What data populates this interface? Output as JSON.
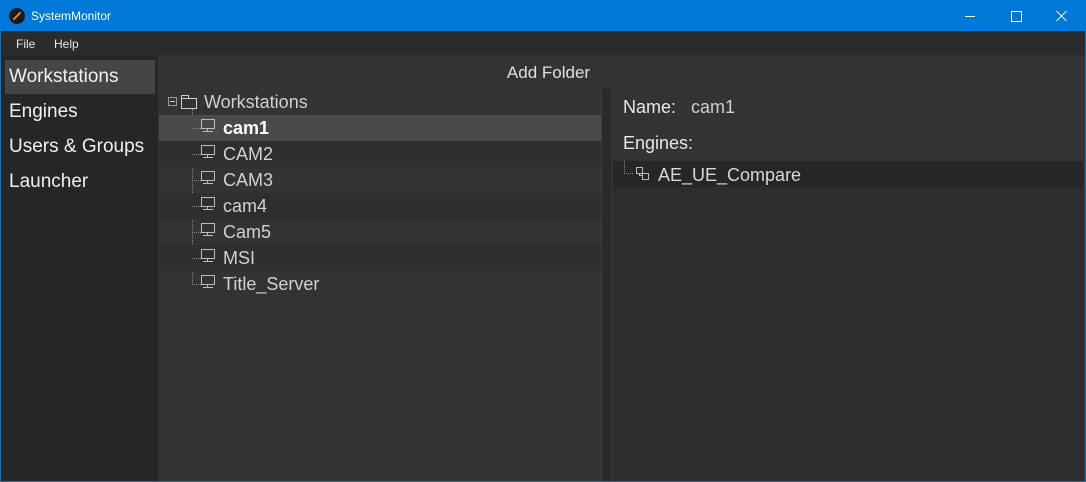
{
  "window": {
    "title": "SystemMonitor",
    "controls": {
      "minimize": "minimize",
      "maximize": "maximize",
      "close": "close"
    }
  },
  "menu": {
    "file": "File",
    "help": "Help"
  },
  "sidebar": {
    "items": [
      {
        "label": "Workstations",
        "active": true
      },
      {
        "label": "Engines"
      },
      {
        "label": "Users & Groups"
      },
      {
        "label": "Launcher"
      }
    ]
  },
  "toolbar": {
    "add_folder": "Add Folder"
  },
  "tree": {
    "root": "Workstations",
    "items": [
      "cam1",
      "CAM2",
      "CAM3",
      "cam4",
      "Cam5",
      "MSI",
      "Title_Server"
    ],
    "selected": "cam1"
  },
  "details": {
    "name_label": "Name:",
    "name_value": "cam1",
    "engines_label": "Engines:",
    "engines": [
      "AE_UE_Compare"
    ]
  },
  "colors": {
    "titlebar": "#0078d7",
    "background": "#333333",
    "sidebar": "#262626",
    "selection": "#4a4a4a"
  },
  "icons": {
    "app": "system-monitor-app-icon",
    "folder": "folder-icon",
    "workstation": "monitor-icon",
    "engine": "engine-hierarchy-icon"
  }
}
